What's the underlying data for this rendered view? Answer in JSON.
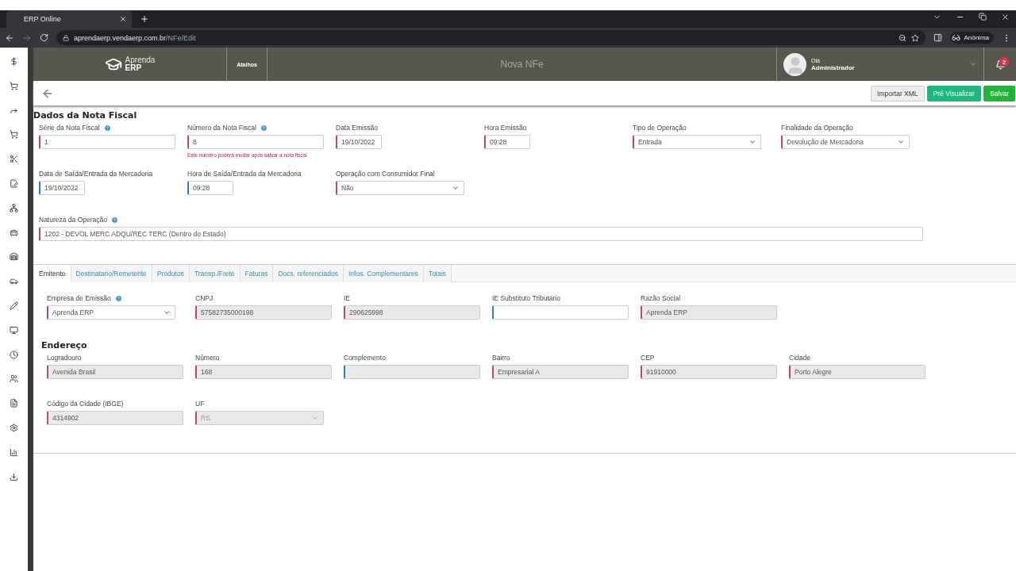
{
  "browser": {
    "tab_title": "ERP Online",
    "url_host": "aprendaerp.vendaerp.com.br",
    "url_path": "/NFe/Edit",
    "profile": "Anônima"
  },
  "header": {
    "logo_top": "Aprenda",
    "logo_bottom": "ERP",
    "shortcuts": "Atalhos",
    "page_title": "Nova NFe",
    "greeting": "Olá",
    "user": "Administrador",
    "notifications": "2"
  },
  "actions": [
    {
      "label": "Importar XML",
      "kind": "default"
    },
    {
      "label": "Pré Visualizar",
      "kind": "info"
    },
    {
      "label": "Salvar",
      "kind": "success"
    }
  ],
  "section_title": "Dados da Nota Fiscal",
  "fields": [
    [
      {
        "label": "Série da Nota Fiscal",
        "help": true,
        "kind": "text",
        "value": "1",
        "required": true,
        "readonly": false
      },
      {
        "label": "Número da Nota Fiscal",
        "help": true,
        "kind": "text",
        "value": "8",
        "required": true,
        "readonly": false,
        "hint": "Este número poderá mudar após salvar a nota fiscal"
      },
      {
        "label": "Data Emissão",
        "help": false,
        "kind": "date",
        "value": "19/10/2022",
        "required": true,
        "readonly": false
      },
      {
        "label": "Hora Emissão",
        "help": false,
        "kind": "time",
        "value": "09:28",
        "required": true,
        "readonly": false
      },
      {
        "label": "Tipo de Operação",
        "help": false,
        "kind": "select",
        "value": "Entrada",
        "required": true,
        "readonly": false
      },
      {
        "label": "Finalidade da Operação",
        "help": false,
        "kind": "select",
        "value": "Devolução de Mercadoria",
        "required": true,
        "readonly": false
      }
    ],
    [
      {
        "label": "Data de Saída/Entrada da Mercadoria",
        "help": false,
        "kind": "date",
        "value": "19/10/2022",
        "required": false,
        "readonly": false
      },
      {
        "label": "Hora de Saída/Entrada da Mercadoria",
        "help": false,
        "kind": "time",
        "value": "09:28",
        "required": false,
        "readonly": false
      },
      {
        "label": "Operação com Consumidor Final",
        "help": false,
        "kind": "select",
        "value": "Não",
        "required": true,
        "readonly": false
      }
    ],
    [
      {
        "label": "Natureza da Operação",
        "help": true,
        "kind": "wide",
        "value": "1202 - DEVOL MERC ADQU/REC TERC (Dentro do Estado)",
        "required": true,
        "readonly": false
      }
    ]
  ],
  "tabs": [
    {
      "label": "Emitente",
      "selected": true
    },
    {
      "label": "Destinatario/Remetente",
      "selected": false
    },
    {
      "label": "Produtos",
      "selected": false
    },
    {
      "label": "Transp./Frete",
      "selected": false
    },
    {
      "label": "Faturas",
      "selected": false
    },
    {
      "label": "Docs. referenciados",
      "selected": false
    },
    {
      "label": "Infos. Complementares",
      "selected": false
    },
    {
      "label": "Totais",
      "selected": false
    }
  ],
  "emitente": [
    [
      {
        "label": "Empresa de Emissão",
        "help": true,
        "kind": "select",
        "value": "Aprenda ERP",
        "required": true,
        "readonly": false
      },
      {
        "label": "CNPJ",
        "help": false,
        "kind": "text",
        "value": "57582735000198",
        "required": true,
        "readonly": true
      },
      {
        "label": "IE",
        "help": false,
        "kind": "text",
        "value": "290625998",
        "required": true,
        "readonly": true
      },
      {
        "label": "IE Substituto Tributario",
        "help": false,
        "kind": "text",
        "required": false,
        "readonly": false
      },
      {
        "label": "Razão Social",
        "help": false,
        "kind": "text",
        "value": "Aprenda ERP",
        "required": true,
        "readonly": true
      }
    ]
  ],
  "address_title": "Endereço",
  "address": [
    [
      {
        "label": "Logradouro",
        "help": false,
        "kind": "text",
        "value": "Avenida Brasil",
        "required": true,
        "readonly": true
      },
      {
        "label": "Número",
        "help": false,
        "kind": "text",
        "value": "168",
        "required": true,
        "readonly": true
      },
      {
        "label": "Complemento",
        "help": false,
        "kind": "text",
        "required": false,
        "readonly": true
      },
      {
        "label": "Bairro",
        "help": false,
        "kind": "text",
        "value": "Empresarial A",
        "required": true,
        "readonly": true
      },
      {
        "label": "CEP",
        "help": false,
        "kind": "text",
        "value": "91910000",
        "required": true,
        "readonly": true
      },
      {
        "label": "Cidade",
        "help": false,
        "kind": "text",
        "value": "Porto Alegre",
        "required": true,
        "readonly": true
      }
    ],
    [
      {
        "label": "Código da Cidade (IBGE)",
        "help": false,
        "kind": "text",
        "value": "4314902",
        "required": true,
        "readonly": true
      },
      {
        "label": "UF",
        "help": false,
        "kind": "select",
        "value": "RS",
        "required": true,
        "readonly": true
      }
    ]
  ]
}
